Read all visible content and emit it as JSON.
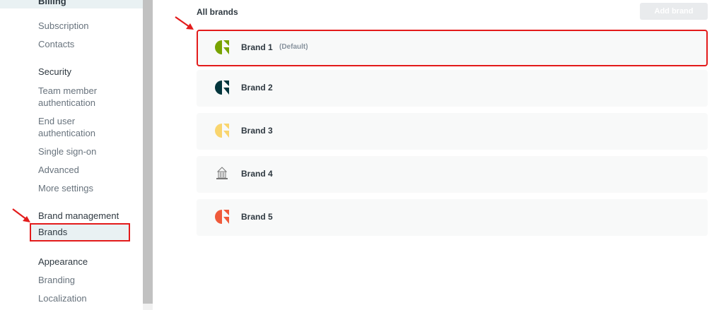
{
  "sidebar": {
    "clipped_heading": "Billing",
    "billing_items": [
      "Subscription",
      "Contacts"
    ],
    "security": {
      "heading": "Security",
      "items": [
        "Team member authentication",
        "End user authentication",
        "Single sign-on",
        "Advanced",
        "More settings"
      ]
    },
    "brand_management": {
      "heading": "Brand management",
      "selected_item": "Brands"
    },
    "appearance": {
      "heading": "Appearance",
      "items": [
        "Branding",
        "Localization"
      ]
    }
  },
  "main": {
    "title": "All brands",
    "add_button_label": "Add brand",
    "brands": [
      {
        "name": "Brand 1",
        "badge": "(Default)",
        "logo": "green-c-logo-icon",
        "color": "#78a300"
      },
      {
        "name": "Brand 2",
        "badge": "",
        "logo": "dark-c-logo-icon",
        "color": "#03363d"
      },
      {
        "name": "Brand 3",
        "badge": "",
        "logo": "yellow-c-logo-icon",
        "color": "#f9d56e"
      },
      {
        "name": "Brand 4",
        "badge": "",
        "logo": "building-logo-icon",
        "color": "#8a8a8a"
      },
      {
        "name": "Brand 5",
        "badge": "",
        "logo": "red-c-logo-icon",
        "color": "#ef5a3b"
      }
    ]
  },
  "colors": {
    "highlight": "#e31b1b",
    "selected_bg": "#e9f1f3",
    "row_bg": "#f8f9f9"
  }
}
